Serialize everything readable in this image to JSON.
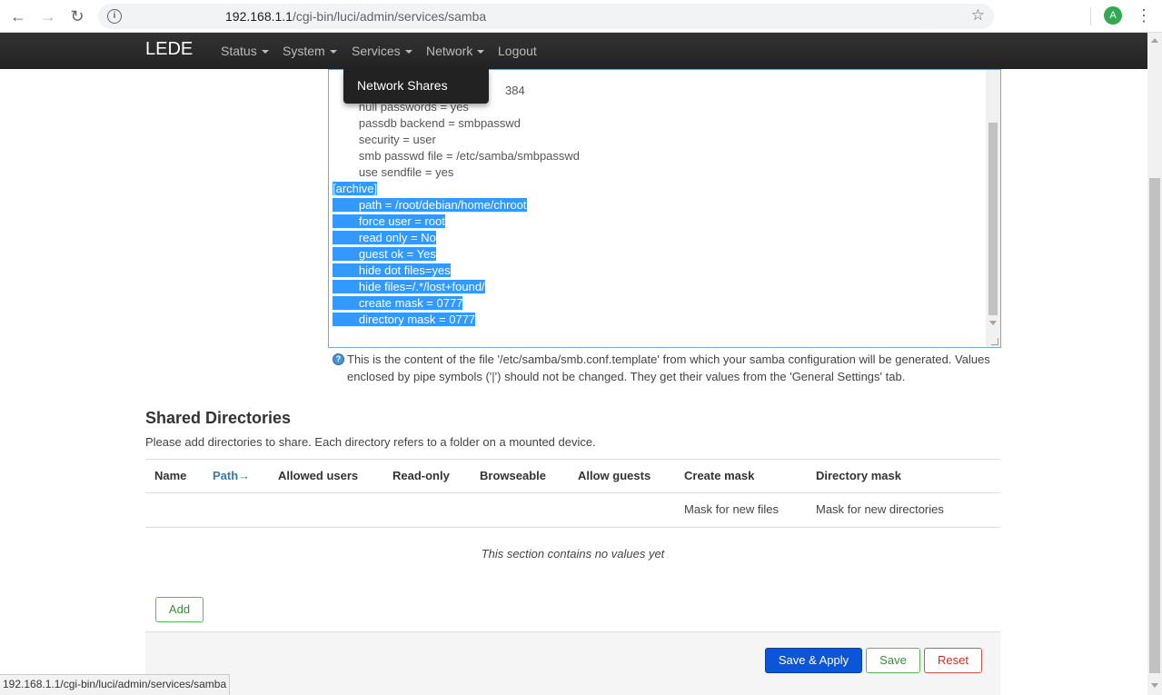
{
  "browser": {
    "url_host": "192.168.1.1",
    "url_path": "/cgi-bin/luci/admin/services/samba",
    "profile_initial": "A"
  },
  "navbar": {
    "brand": "LEDE",
    "items": [
      {
        "label": "Status"
      },
      {
        "label": "System"
      },
      {
        "label": "Services"
      },
      {
        "label": "Network"
      },
      {
        "label": "Logout"
      }
    ],
    "dropdown_item": "Network Shares"
  },
  "template": {
    "partial_top": "384",
    "lines": [
      "        null passwords = yes",
      "        passdb backend = smbpasswd",
      "        security = user",
      "        smb passwd file = /etc/samba/smbpasswd",
      "        use sendfile = yes"
    ],
    "selected_lines": [
      "[archive]",
      "        path = /root/debian/home/chroot",
      "        force user = root",
      "        read only = No",
      "        guest ok = Yes",
      "        hide dot files=yes",
      "        hide files=/.*/lost+found/",
      "        create mask = 0777",
      "        directory mask = 0777"
    ],
    "help": "This is the content of the file '/etc/samba/smb.conf.template' from which your samba configuration will be generated. Values enclosed by pipe symbols ('|') should not be changed. They get their values from the 'General Settings' tab."
  },
  "shared": {
    "title": "Shared Directories",
    "description": "Please add directories to share. Each directory refers to a folder on a mounted device.",
    "columns": {
      "name": "Name",
      "path": "Path→",
      "allowed_users": "Allowed users",
      "read_only": "Read-only",
      "browseable": "Browseable",
      "allow_guests": "Allow guests",
      "create_mask": "Create mask",
      "directory_mask": "Directory mask"
    },
    "create_mask_desc": "Mask for new files",
    "directory_mask_desc": "Mask for new directories",
    "empty": "This section contains no values yet",
    "add_label": "Add"
  },
  "footer": {
    "save_apply": "Save & Apply",
    "save": "Save",
    "reset": "Reset"
  },
  "status_bar": "192.168.1.1/cgi-bin/luci/admin/services/samba",
  "colors": {
    "navbar": "#222222",
    "primary_button": "#0b55d8",
    "selection": "#3399ff",
    "link": "#337ab7"
  }
}
